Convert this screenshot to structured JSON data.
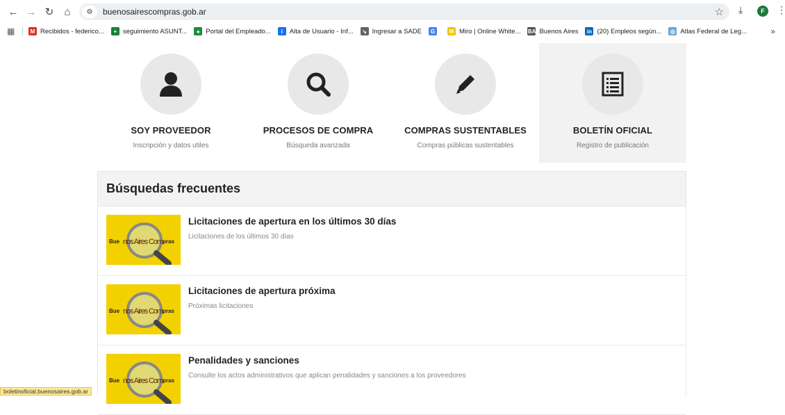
{
  "browser": {
    "url": "buenosairescompras.gob.ar",
    "profile_initial": "F",
    "bookmarks": [
      {
        "label": "Recibidos - federico...",
        "color": "#d93025",
        "glyph": "M"
      },
      {
        "label": "seguimiento ASUNT...",
        "color": "#188038",
        "glyph": "+"
      },
      {
        "label": "Portal del Empleado...",
        "color": "#1e8e3e",
        "glyph": "●"
      },
      {
        "label": "Alta de Usuario - Inf...",
        "color": "#1a73e8",
        "glyph": "i"
      },
      {
        "label": "Ingresar a SADE",
        "color": "#5f6368",
        "glyph": "↘"
      },
      {
        "label": "",
        "color": "#4285f4",
        "glyph": "G"
      },
      {
        "label": "Miro | Online White...",
        "color": "#f5c400",
        "glyph": "M"
      },
      {
        "label": "Buenos Aires",
        "color": "#555555",
        "glyph": "BA"
      },
      {
        "label": "(20) Empleos según...",
        "color": "#0a66c2",
        "glyph": "in"
      },
      {
        "label": "Atlas Federal de Leg...",
        "color": "#6aa6d8",
        "glyph": "◎"
      }
    ]
  },
  "tiles": [
    {
      "title": "SOY PROVEEDOR",
      "subtitle": "Inscripción y datos utiles",
      "icon": "user-icon"
    },
    {
      "title": "PROCESOS DE COMPRA",
      "subtitle": "Búsqueda avanzada",
      "icon": "search-icon"
    },
    {
      "title": "COMPRAS SUSTENTABLES",
      "subtitle": "Compras públicas sustentables",
      "icon": "pencil-icon"
    },
    {
      "title": "BOLETÍN OFICIAL",
      "subtitle": "Registro de publicación",
      "icon": "document-list-icon"
    }
  ],
  "frequent": {
    "heading": "Búsquedas frecuentes",
    "logo_text": [
      "Bue",
      "nos Aires Com",
      "pras"
    ],
    "items": [
      {
        "title": "Licitaciones de apertura en los últimos 30 días",
        "subtitle": "Licitaciones de los últimos 30 días"
      },
      {
        "title": "Licitaciones de apertura próxima",
        "subtitle": "Próximas licitaciones"
      },
      {
        "title": "Penalidades y sanciones",
        "subtitle": "Consulte los actos administrativos que aplican penalidades y sanciones a los proveedores"
      }
    ]
  },
  "status_bar": "boletinoficial.buenosaires.gob.ar",
  "colors": {
    "logo_yellow": "#f3d100",
    "tile_circle": "#e8e8e8",
    "active_tile": "#f2f2f2"
  }
}
